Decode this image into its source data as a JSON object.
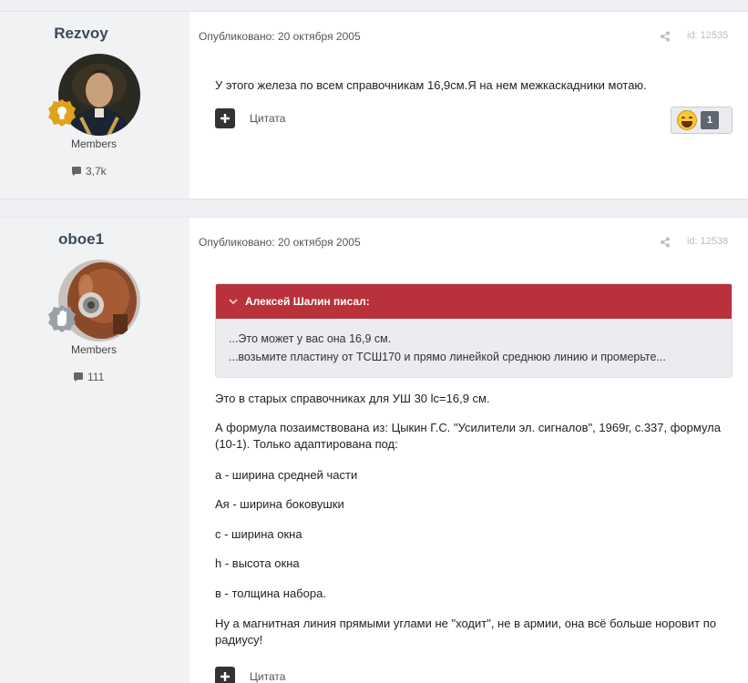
{
  "posts": [
    {
      "author": "Rezvoy",
      "group": "Members",
      "post_count": "3,7k",
      "published": "Опубликовано: 20 октября 2005",
      "id": "id: 12535",
      "body": [
        "У этого железа по всем справочникам 16,9см.Я на нем межкаскадники мотаю."
      ],
      "quote_label": "Цитата",
      "reaction_count": "1",
      "badge_icon": "lightbulb-icon"
    },
    {
      "author": "oboe1",
      "group": "Members",
      "post_count": "111",
      "published": "Опубликовано: 20 октября 2005",
      "id": "id: 12538",
      "quote": {
        "author": "Алексей Шалин писал:",
        "lines": [
          "...Это может у вас она 16,9 см.",
          "...возьмите пластину от ТСШ170 и прямо линейкой среднюю линию и промерьте..."
        ]
      },
      "body": [
        "Это в старых справочниках для УШ 30 lc=16,9 см.",
        "А формула позаимствована из: Цыкин Г.С. \"Усилители эл. сигналов\", 1969г, с.337, формула (10-1). Только адаптирована под:",
        "а - ширина средней части",
        "Ая - ширина боковушки",
        "с - ширина окна",
        "h - высота окна",
        "в - толщина набора.",
        "Ну а магнитная линия прямыми углами не \"ходит\", не в армии, она всё больше норовит по радиусу!"
      ],
      "quote_label": "Цитата",
      "badge_icon": "hand-icon"
    }
  ],
  "colors": {
    "quote_header": "#b9313a",
    "badge_gold": "#e0a21b",
    "badge_gray": "#9aa0a8"
  }
}
